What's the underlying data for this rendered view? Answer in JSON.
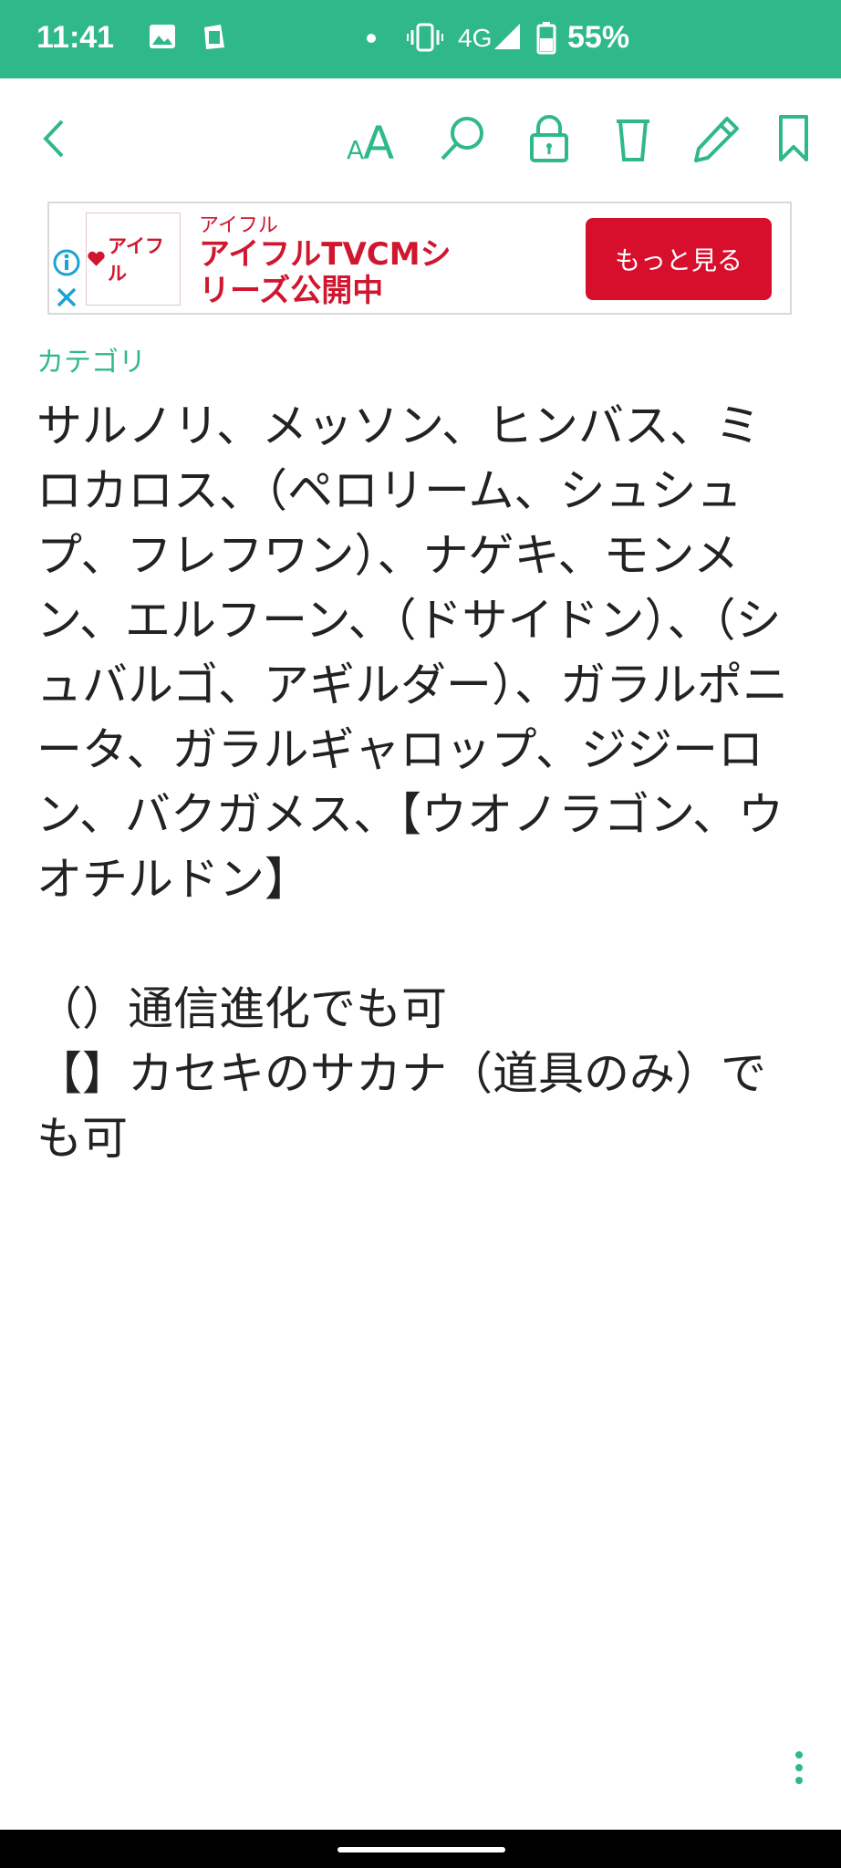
{
  "status_bar": {
    "time": "11:41",
    "network": "4G",
    "battery": "55%",
    "icons": [
      "image-icon",
      "clipboard-icon",
      "notification-dot",
      "vibrate-icon",
      "signal-icon",
      "battery-icon"
    ]
  },
  "toolbar": {
    "font_size_label": "AA",
    "icons": [
      "back-icon",
      "font-size-icon",
      "search-icon",
      "lock-icon",
      "trash-icon",
      "edit-icon",
      "bookmark-icon"
    ]
  },
  "ad": {
    "logo_text": "アイフル",
    "advertiser": "アイフル",
    "headline": "アイフルTVCMシリーズ公開中",
    "cta_label": "もっと見る"
  },
  "note": {
    "category": "カテゴリ",
    "body": "サルノリ、メッソン、ヒンバス、ミロカロス、（ペロリーム、シュシュプ、フレフワン）、ナゲキ、モンメン、エルフーン、（ドサイドン）、（シュバルゴ、アギルダー）、ガラルポニータ、ガラルギャロップ、ジジーロン、バクガメス、【ウオノラゴン、ウオチルドン】\n\n（）通信進化でも可\n【】カセキのサカナ（道具のみ）でも可"
  },
  "colors": {
    "accent": "#2fb98b",
    "ad_red": "#d80f2c",
    "text": "#222222"
  }
}
